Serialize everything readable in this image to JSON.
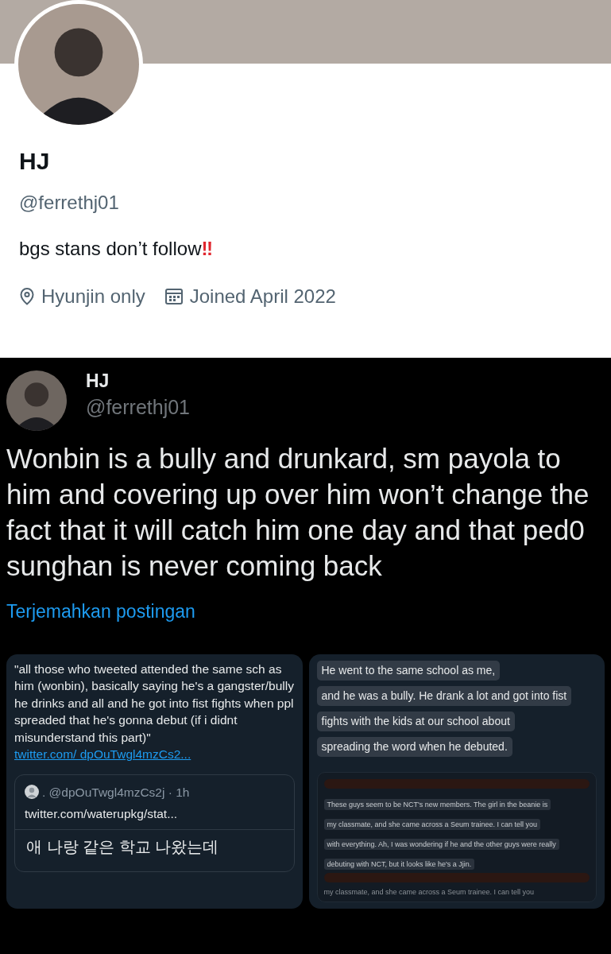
{
  "profile": {
    "name": "HJ",
    "handle": "@ferrethj01",
    "bio": {
      "text": "bgs stans don’t follow",
      "emoji": "‼"
    },
    "location": "Hyunjin only",
    "joined": "Joined April 2022"
  },
  "post": {
    "name": "HJ",
    "handle": "@ferrethj01",
    "text": "Wonbin is a bully and drunkard, sm payola to him and covering up over him won’t change the fact that it will catch him one day and that ped0 sunghan is never coming back",
    "translate": "Terjemahkan postingan",
    "attachments": [
      {
        "kind": "tweet",
        "text": "\"all those who tweeted attended the same sch as him (wonbin), basically saying he's a gangster/bully he drinks and all and he got into fist fights when ppl spreaded that he's gonna debut (if i didnt misunderstand this part)\"",
        "link": "twitter.com/ dpOuTwgl4mzCs2...",
        "quote": {
          "author": ". @dpOuTwgl4mzCs2j · 1h",
          "text": "twitter.com/waterupkg/stat...",
          "body": "애 나랑 같은 학교 나왔는데"
        }
      },
      {
        "kind": "captions",
        "lines": [
          "He went to the same school as me,",
          "and he was a bully. He drank a lot and got into fist",
          "fights with the kids at our school about",
          "spreading the word when he debuted."
        ],
        "inner_lines": [
          "These guys seem to be NCT's new members. The girl in the beanie is",
          "my classmate, and she came across a Seum trainee. I can tell you",
          "with everything. Ah, I was wondering if he and the other guys were really",
          "debuting with NCT, but it looks like he's a Jjin."
        ],
        "trailing_line": "my classmate, and she came across a Seum trainee. I can tell you"
      }
    ]
  }
}
